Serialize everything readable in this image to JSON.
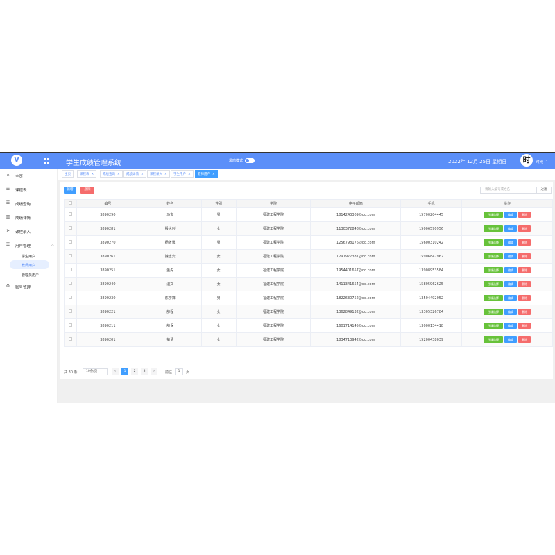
{
  "header": {
    "logo_text": "V",
    "title": "学生成绩管理系统",
    "dark_mode_label": "黑暗模式",
    "date": "2022年 12月 25日   星期日",
    "avatar_text": "时",
    "username": "时光"
  },
  "sidebar": {
    "items": [
      {
        "label": "主页",
        "icon": "home-icon"
      },
      {
        "label": "课程表",
        "icon": "list-icon"
      },
      {
        "label": "成绩查询",
        "icon": "list-icon"
      },
      {
        "label": "成绩详情",
        "icon": "chart-icon"
      },
      {
        "label": "课程录入",
        "icon": "send-icon"
      },
      {
        "label": "用户管理",
        "icon": "list-icon"
      },
      {
        "label": "账号管理",
        "icon": "gear-icon"
      }
    ],
    "sub_items": [
      {
        "label": "学生用户"
      },
      {
        "label": "教师用户"
      },
      {
        "label": "管理员用户"
      }
    ]
  },
  "tabs": [
    {
      "label": "主页"
    },
    {
      "label": "课程表"
    },
    {
      "label": "成绩查询"
    },
    {
      "label": "成绩详情"
    },
    {
      "label": "课程录入"
    },
    {
      "label": "学生用户"
    },
    {
      "label": "教师用户"
    }
  ],
  "toolbar": {
    "add_label": "新增",
    "delete_label": "删除",
    "search_placeholder": "请输入编号或姓名",
    "filter_label": "过滤"
  },
  "table": {
    "headers": [
      "编号",
      "姓名",
      "性别",
      "学院",
      "电子邮箱",
      "手机",
      "操作"
    ],
    "rows": [
      [
        "3890290",
        "马文",
        "男",
        "福建工程学院",
        "1814243309@qq.com",
        "15700204445"
      ],
      [
        "3890281",
        "殷义兴",
        "女",
        "福建工程学院",
        "1130372848@qq.com",
        "15006590956"
      ],
      [
        "3890270",
        "杨敬勇",
        "男",
        "福建工程学院",
        "1256798176@qq.com",
        "15600310242"
      ],
      [
        "3890261",
        "魏志安",
        "女",
        "福建工程学院",
        "1291977381@qq.com",
        "15906847962"
      ],
      [
        "3890251",
        "金先",
        "女",
        "福建工程学院",
        "1954401657@qq.com",
        "13908953584"
      ],
      [
        "3890240",
        "温文",
        "女",
        "福建工程学院",
        "1411341654@qq.com",
        "15805962625"
      ],
      [
        "3890230",
        "陈学祥",
        "男",
        "福建工程学院",
        "1822630752@qq.com",
        "13504492052"
      ],
      [
        "3890221",
        "薛程",
        "女",
        "福建工程学院",
        "1362849132@qq.com",
        "13305326784"
      ],
      [
        "3890211",
        "薛保",
        "女",
        "福建工程学院",
        "1601714145@qq.com",
        "13000134418"
      ],
      [
        "3890201",
        "菊请",
        "女",
        "福建工程学院",
        "1834713942@qq.com",
        "15200438039"
      ]
    ],
    "op_labels": {
      "course": "任课选择",
      "edit": "编辑",
      "delete": "删除"
    }
  },
  "pagination": {
    "total": "共 30 条",
    "page_size": "10条/页",
    "pages": [
      "1",
      "2",
      "3"
    ],
    "current": "1",
    "goto_prefix": "前往",
    "goto_value": "1",
    "goto_suffix": "页"
  }
}
